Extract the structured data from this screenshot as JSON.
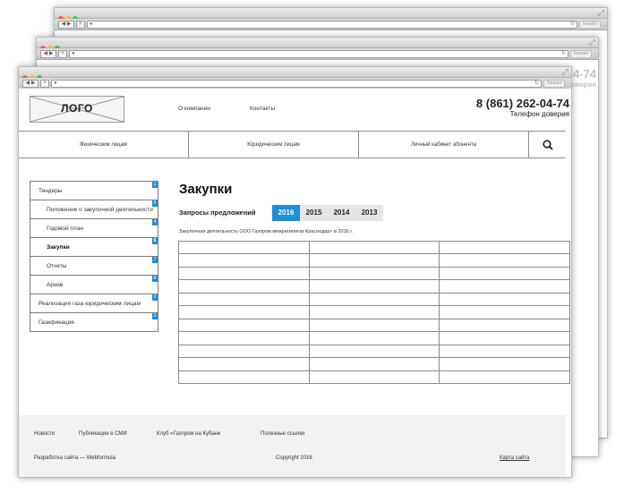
{
  "window": {
    "reader_label": "Reader",
    "ghost_phone": "4-74",
    "ghost_hotline": "доверия"
  },
  "header": {
    "logo_text": "ЛОГО",
    "nav": [
      "О компании",
      "Контакты"
    ],
    "phone": "8 (861) 262-04-74",
    "hotline": "Телефон доверия"
  },
  "menu": {
    "items": [
      "Физическим лицам",
      "Юридическим лицам",
      "Личный кабинет абонента"
    ]
  },
  "sidebar": {
    "items": [
      {
        "label": "Тендеры",
        "badge": "1",
        "level": "top"
      },
      {
        "label": "Положение о закупочной деятельности",
        "badge": "5",
        "level": "sub"
      },
      {
        "label": "Годовой план",
        "badge": "4",
        "level": "sub"
      },
      {
        "label": "Закупки",
        "badge": "6",
        "level": "sub",
        "active": true
      },
      {
        "label": "Отчеты",
        "badge": "7",
        "level": "sub"
      },
      {
        "label": "Архив",
        "badge": "8",
        "level": "sub"
      },
      {
        "label": "Реализация газа юридическим лицам",
        "badge": "2",
        "level": "top"
      },
      {
        "label": "Газификация",
        "badge": "3",
        "level": "top"
      }
    ]
  },
  "main": {
    "title": "Закупки",
    "requests_label": "Запросы предложений",
    "years": [
      "2016",
      "2015",
      "2014",
      "2013"
    ],
    "selected_year": "2016",
    "description": "Закупочная деятельность ООО Газпром межрегионгаз Краснодар» в 2016 г."
  },
  "footer": {
    "links": [
      "Новости",
      "Публикации в СМИ",
      "Клуб «Газпром на Кубани",
      "Полезные ссылки"
    ],
    "developer": "Разработка сайта — Webformula",
    "copyright": "Copyright 2016",
    "sitemap": "Карта сайта"
  },
  "colors": {
    "accent": "#1d8fd6",
    "footer_bg": "#f2f2f2",
    "border": "#8c8c8c"
  }
}
